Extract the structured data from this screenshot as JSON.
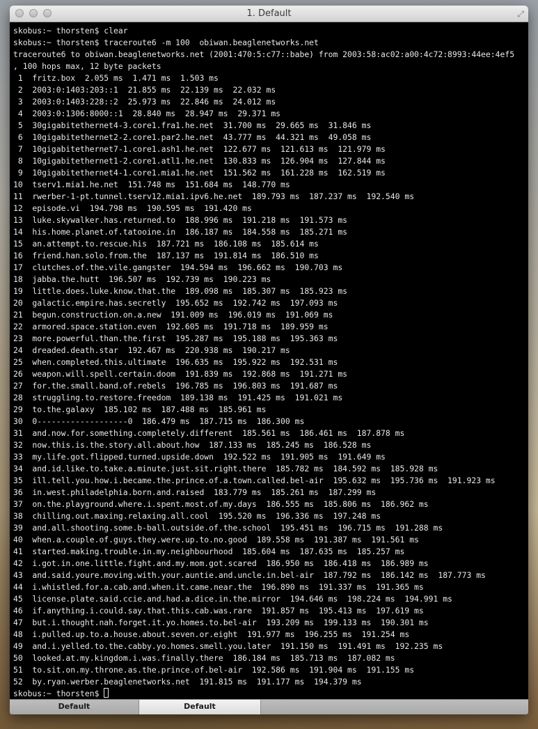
{
  "window": {
    "title": "1. Default"
  },
  "terminal": {
    "lines": [
      "skobus:~ thorsten$ clear",
      "skobus:~ thorsten$ traceroute6 -m 100  obiwan.beaglenetworks.net",
      "traceroute6 to obiwan.beaglenetworks.net (2001:470:5:c77::babe) from 2003:58:ac02:a00:4c72:8993:44ee:4ef5",
      ", 100 hops max, 12 byte packets",
      " 1  fritz.box  2.055 ms  1.471 ms  1.503 ms",
      " 2  2003:0:1403:203::1  21.855 ms  22.139 ms  22.032 ms",
      " 3  2003:0:1403:228::2  25.973 ms  22.846 ms  24.012 ms",
      " 4  2003:0:1306:8000::1  28.840 ms  28.947 ms  29.371 ms",
      " 5  30gigabitethernet4-3.core1.fra1.he.net  31.700 ms  29.665 ms  31.846 ms",
      " 6  10gigabitethernet2-2.core1.par2.he.net  43.777 ms  44.321 ms  49.058 ms",
      " 7  10gigabitethernet7-1.core1.ash1.he.net  122.677 ms  121.613 ms  121.979 ms",
      " 8  10gigabitethernet1-2.core1.atl1.he.net  130.833 ms  126.904 ms  127.844 ms",
      " 9  10gigabitethernet4-1.core1.mia1.he.net  151.562 ms  161.228 ms  162.519 ms",
      "10  tserv1.mia1.he.net  151.748 ms  151.684 ms  148.770 ms",
      "11  rwerber-1-pt.tunnel.tserv12.mia1.ipv6.he.net  189.793 ms  187.237 ms  192.540 ms",
      "12  episode.vi  194.798 ms  190.595 ms  191.420 ms",
      "13  luke.skywalker.has.returned.to  188.996 ms  191.218 ms  191.573 ms",
      "14  his.home.planet.of.tatooine.in  186.187 ms  184.558 ms  185.271 ms",
      "15  an.attempt.to.rescue.his  187.721 ms  186.108 ms  185.614 ms",
      "16  friend.han.solo.from.the  187.137 ms  191.814 ms  186.510 ms",
      "17  clutches.of.the.vile.gangster  194.594 ms  196.662 ms  190.703 ms",
      "18  jabba.the.hutt  196.507 ms  192.739 ms  190.223 ms",
      "19  little.does.luke.know.that.the  189.098 ms  185.307 ms  185.923 ms",
      "20  galactic.empire.has.secretly  195.652 ms  192.742 ms  197.093 ms",
      "21  begun.construction.on.a.new  191.009 ms  196.019 ms  191.069 ms",
      "22  armored.space.station.even  192.605 ms  191.718 ms  189.959 ms",
      "23  more.powerful.than.the.first  195.287 ms  195.188 ms  195.363 ms",
      "24  dreaded.death.star  192.467 ms  220.938 ms  190.217 ms",
      "25  when.completed.this.ultimate  196.635 ms  195.922 ms  192.531 ms",
      "26  weapon.will.spell.certain.doom  191.839 ms  192.868 ms  191.271 ms",
      "27  for.the.small.band.of.rebels  196.785 ms  196.803 ms  191.687 ms",
      "28  struggling.to.restore.freedom  189.138 ms  191.425 ms  191.021 ms",
      "29  to.the.galaxy  185.102 ms  187.488 ms  185.961 ms",
      "30  0-------------------0  186.479 ms  187.715 ms  186.300 ms",
      "31  and.now.for.something.completely.different  185.561 ms  186.461 ms  187.878 ms",
      "32  now.this.is.the.story.all.about.how  187.133 ms  185.245 ms  186.528 ms",
      "33  my.life.got.flipped.turned.upside.down  192.522 ms  191.905 ms  191.649 ms",
      "34  and.id.like.to.take.a.minute.just.sit.right.there  185.782 ms  184.592 ms  185.928 ms",
      "35  ill.tell.you.how.i.became.the.prince.of.a.town.called.bel-air  195.632 ms  195.736 ms  191.923 ms",
      "36  in.west.philadelphia.born.and.raised  183.779 ms  185.261 ms  187.299 ms",
      "37  on.the.playground.where.i.spent.most.of.my.days  186.555 ms  185.806 ms  186.962 ms",
      "38  chilling.out.maxing.relaxing.all.cool  195.520 ms  196.336 ms  197.248 ms",
      "39  and.all.shooting.some.b-ball.outside.of.the.school  195.451 ms  196.715 ms  191.288 ms",
      "40  when.a.couple.of.guys.they.were.up.to.no.good  189.558 ms  191.387 ms  191.561 ms",
      "41  started.making.trouble.in.my.neighbourhood  185.604 ms  187.635 ms  185.257 ms",
      "42  i.got.in.one.little.fight.and.my.mom.got.scared  186.950 ms  186.418 ms  186.989 ms",
      "43  and.said.youre.moving.with.your.auntie.and.uncle.in.bel-air  187.792 ms  186.142 ms  187.773 ms",
      "44  i.whistled.for.a.cab.and.when.it.came.near.the  196.890 ms  191.337 ms  191.365 ms",
      "45  license.plate.said.ccie.and.had.a.dice.in.the.mirror  194.646 ms  198.224 ms  194.991 ms",
      "46  if.anything.i.could.say.that.this.cab.was.rare  191.857 ms  195.413 ms  197.619 ms",
      "47  but.i.thought.nah.forget.it.yo.homes.to.bel-air  193.209 ms  199.133 ms  190.301 ms",
      "48  i.pulled.up.to.a.house.about.seven.or.eight  191.977 ms  196.255 ms  191.254 ms",
      "49  and.i.yelled.to.the.cabby.yo.homes.smell.you.later  191.150 ms  191.491 ms  192.235 ms",
      "50  looked.at.my.kingdom.i.was.finally.there  186.184 ms  185.713 ms  187.082 ms",
      "51  to.sit.on.my.throne.as.the.prince.of.bel-air  192.586 ms  191.904 ms  191.155 ms",
      "52  by.ryan.werber.beaglenetworks.net  191.815 ms  191.177 ms  194.379 ms"
    ],
    "prompt": "skobus:~ thorsten$ "
  },
  "tabs": [
    {
      "label": "Default"
    },
    {
      "label": "Default"
    }
  ]
}
